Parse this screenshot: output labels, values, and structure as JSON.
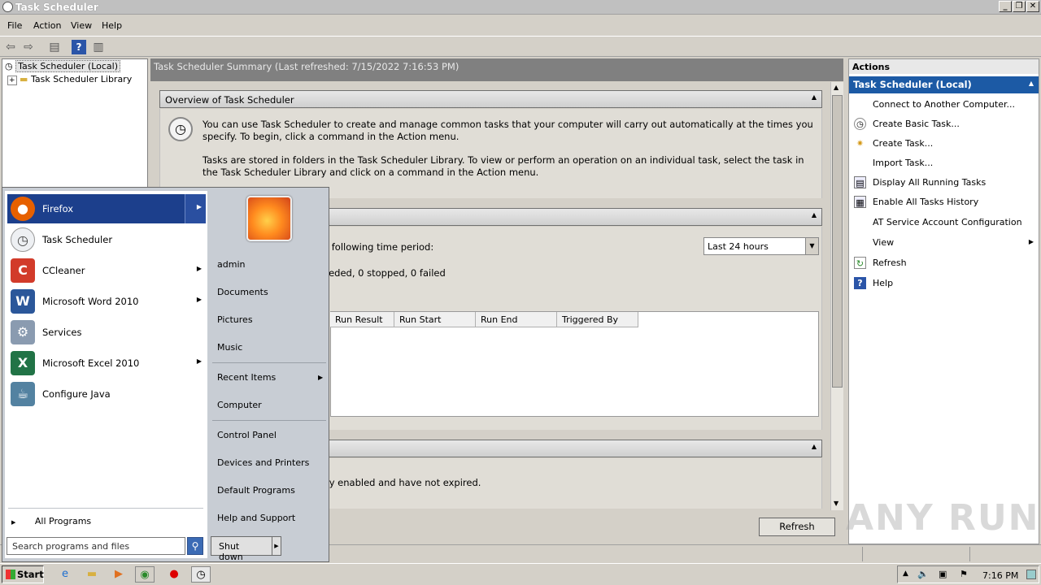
{
  "window": {
    "title": "Task Scheduler"
  },
  "menubar": [
    "File",
    "Action",
    "View",
    "Help"
  ],
  "tree": {
    "root": "Task Scheduler (Local)",
    "child": "Task Scheduler Library"
  },
  "center": {
    "header": "Task Scheduler Summary (Last refreshed: 7/15/2022 7:16:53 PM)",
    "overview_title": "Overview of Task Scheduler",
    "overview_p1": "You can use Task Scheduler to create and manage common tasks that your computer will carry out automatically at the times you specify. To begin, click a command in the Action menu.",
    "overview_p2": "Tasks are stored in folders in the Task Scheduler Library. To view or perform an operation on an individual task, select the task in the Task Scheduler Library and click on a command in the Action menu.",
    "status_period_text": "e following time period:",
    "period_select": "Last 24 hours",
    "status_counts_text": "eeded, 0 stopped, 0 failed",
    "table_columns": [
      "Run Result",
      "Run Start",
      "Run End",
      "Triggered By"
    ],
    "active_text": "tly enabled and have not expired.",
    "refresh_button": "Refresh"
  },
  "actions": {
    "title": "Actions",
    "subheader": "Task Scheduler (Local)",
    "items": [
      {
        "label": "Connect to Another Computer...",
        "icon": ""
      },
      {
        "label": "Create Basic Task...",
        "icon": "clock-icon"
      },
      {
        "label": "Create Task...",
        "icon": "task-icon"
      },
      {
        "label": "Import Task...",
        "icon": ""
      },
      {
        "label": "Display All Running Tasks",
        "icon": "list-icon"
      },
      {
        "label": "Enable All Tasks History",
        "icon": "history-icon"
      },
      {
        "label": "AT Service Account Configuration",
        "icon": ""
      },
      {
        "label": "View",
        "icon": ""
      },
      {
        "label": "Refresh",
        "icon": "refresh-icon"
      },
      {
        "label": "Help",
        "icon": "help-icon"
      }
    ]
  },
  "startmenu": {
    "programs": [
      {
        "label": "Firefox",
        "icon": "firefox-icon",
        "color": "#e66000",
        "glyph": "●"
      },
      {
        "label": "Task Scheduler",
        "icon": "task-scheduler-icon",
        "color": "#cfd4da",
        "glyph": "◷"
      },
      {
        "label": "CCleaner",
        "icon": "ccleaner-icon",
        "color": "#d23b2a",
        "glyph": "C"
      },
      {
        "label": "Microsoft Word 2010",
        "icon": "word-icon",
        "color": "#2b579a",
        "glyph": "W"
      },
      {
        "label": "Services",
        "icon": "services-icon",
        "color": "#8a9bb0",
        "glyph": "⚙"
      },
      {
        "label": "Microsoft Excel 2010",
        "icon": "excel-icon",
        "color": "#217346",
        "glyph": "X"
      },
      {
        "label": "Configure Java",
        "icon": "java-icon",
        "color": "#5382a1",
        "glyph": "☕"
      }
    ],
    "all_programs": "All Programs",
    "search_placeholder": "Search programs and files",
    "right": {
      "user": "admin",
      "documents": "Documents",
      "pictures": "Pictures",
      "music": "Music",
      "recent": "Recent Items",
      "computer": "Computer",
      "control_panel": "Control Panel",
      "devices": "Devices and Printers",
      "defaults": "Default Programs",
      "help": "Help and Support"
    },
    "shutdown": "Shut down"
  },
  "taskbar": {
    "start": "Start",
    "clock": "7:16 PM"
  },
  "watermark": "ANY RUN"
}
